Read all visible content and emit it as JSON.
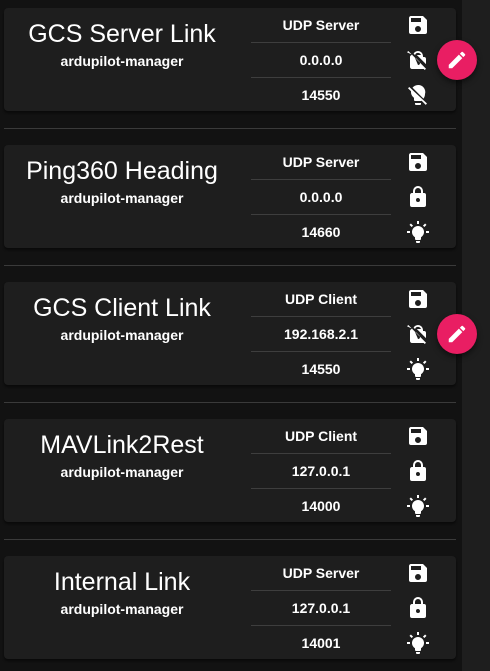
{
  "links": [
    {
      "name": "GCS Server Link",
      "manager": "ardupilot-manager",
      "type": "UDP Server",
      "ip": "0.0.0.0",
      "port": "14550",
      "icons": [
        "content-save-icon",
        "lock-off-icon",
        "lightbulb-off-icon"
      ],
      "editable": true
    },
    {
      "name": "Ping360 Heading",
      "manager": "ardupilot-manager",
      "type": "UDP Server",
      "ip": "0.0.0.0",
      "port": "14660",
      "icons": [
        "content-save-icon",
        "lock-icon",
        "lightbulb-on-icon"
      ],
      "editable": false
    },
    {
      "name": "GCS Client Link",
      "manager": "ardupilot-manager",
      "type": "UDP Client",
      "ip": "192.168.2.1",
      "port": "14550",
      "icons": [
        "content-save-icon",
        "lock-off-icon",
        "lightbulb-on-icon"
      ],
      "editable": true
    },
    {
      "name": "MAVLink2Rest",
      "manager": "ardupilot-manager",
      "type": "UDP Client",
      "ip": "127.0.0.1",
      "port": "14000",
      "icons": [
        "content-save-icon",
        "lock-icon",
        "lightbulb-on-icon"
      ],
      "editable": false
    },
    {
      "name": "Internal Link",
      "manager": "ardupilot-manager",
      "type": "UDP Server",
      "ip": "127.0.0.1",
      "port": "14001",
      "icons": [
        "content-save-icon",
        "lock-icon",
        "lightbulb-on-icon"
      ],
      "editable": false
    }
  ],
  "colors": {
    "accent": "#e91e63",
    "card": "#1e1e1e",
    "background": "#121212"
  },
  "edit_icon": "pencil-icon"
}
